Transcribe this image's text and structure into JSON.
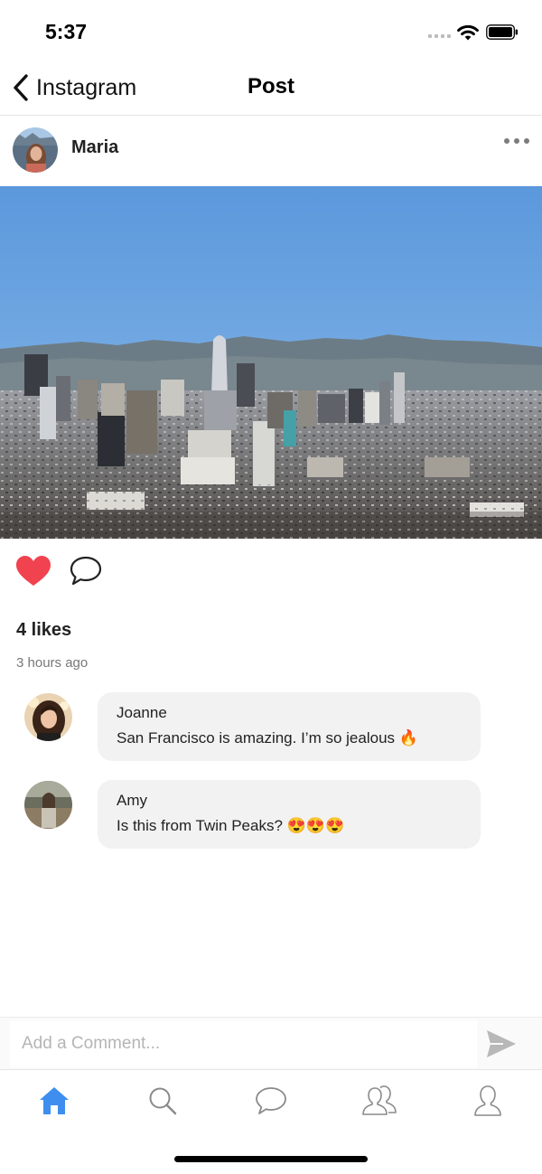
{
  "status_bar": {
    "time": "5:37"
  },
  "nav": {
    "back_label": "Instagram",
    "title": "Post"
  },
  "post": {
    "author": "Maria",
    "likes": "4 likes",
    "time_ago": "3 hours ago",
    "liked": true,
    "like_color": "#f0434f",
    "image": "city-skyline-photo"
  },
  "comments": [
    {
      "author": "Joanne",
      "text": "San Francisco is amazing. I’m so jealous 🔥"
    },
    {
      "author": "Amy",
      "text": "Is this from Twin Peaks? 😍😍😍"
    }
  ],
  "composer": {
    "placeholder": "Add a Comment..."
  },
  "tabs": [
    {
      "name": "home",
      "icon": "home-icon",
      "active": true
    },
    {
      "name": "search",
      "icon": "search-icon",
      "active": false
    },
    {
      "name": "chat",
      "icon": "chat-bubble-icon",
      "active": false
    },
    {
      "name": "friends",
      "icon": "people-icon",
      "active": false
    },
    {
      "name": "profile",
      "icon": "person-icon",
      "active": false
    }
  ],
  "colors": {
    "accent": "#3e8ef0",
    "inactive_icon": "#8a8a8a"
  }
}
